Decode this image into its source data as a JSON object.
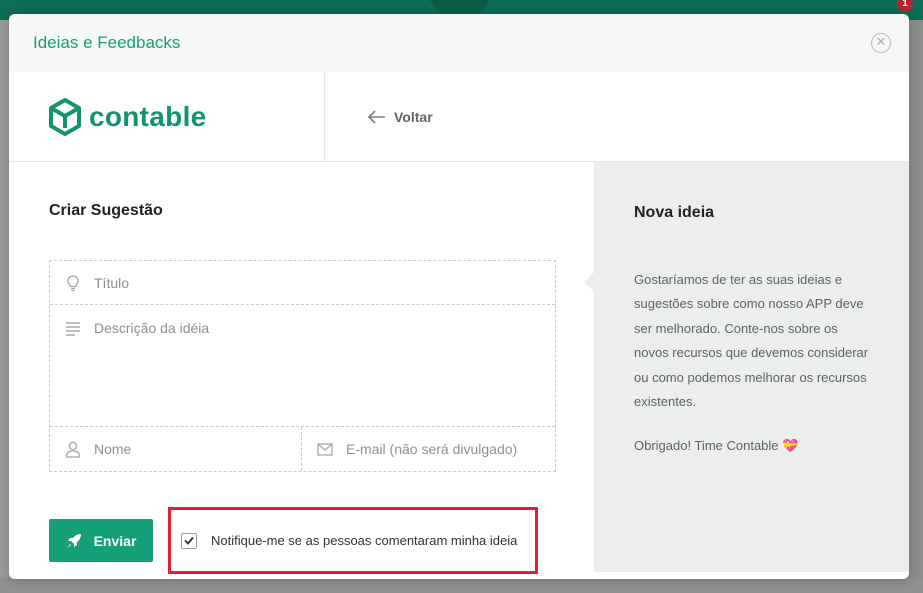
{
  "modal": {
    "title": "Ideias e Feedbacks",
    "close_icon": "close-icon"
  },
  "brand": {
    "logo_text": "contable",
    "back_label": "Voltar"
  },
  "form": {
    "section_title": "Criar Sugestão",
    "title_placeholder": "Título",
    "description_placeholder": "Descrição da idéia",
    "name_placeholder": "Nome",
    "email_placeholder": "E-mail (não será divulgado)",
    "send_label": "Enviar",
    "notify_label": "Notifique-me se as pessoas comentaram minha ideia",
    "notify_checked": true
  },
  "info": {
    "title": "Nova ideia",
    "text": "Gostaríamos de ter as suas ideias e sugestões sobre como nosso APP deve ser melhorado. Conte-nos sobre os novos recursos que devemos considerar ou como podemos melhorar os recursos existentes.",
    "thanks": "Obrigado! Time Contable",
    "emoji": "💝"
  },
  "background": {
    "badge": "1"
  },
  "colors": {
    "brand_green": "#15a07a",
    "highlight_red": "#e4202f",
    "panel_gray": "#eceeee"
  }
}
